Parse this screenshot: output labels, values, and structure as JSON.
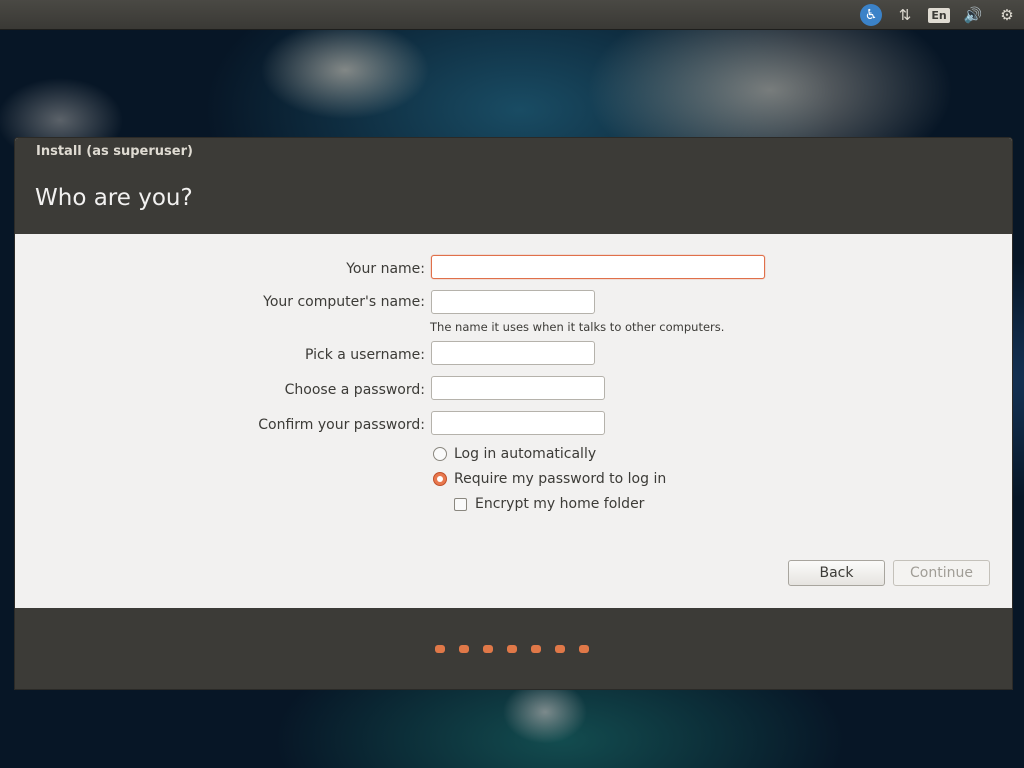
{
  "topbar": {
    "icons": [
      "accessibility-icon",
      "network-icon",
      "keyboard-language-icon",
      "volume-icon",
      "gear-icon"
    ],
    "language": "En",
    "accent_color": "#3b82c8"
  },
  "window": {
    "title": "Install (as superuser)",
    "heading": "Who are you?",
    "form": {
      "name_label": "Your name:",
      "name_value": "",
      "computer_label": "Your computer's name:",
      "computer_value": "",
      "computer_hint": "The name it uses when it talks to other computers.",
      "username_label": "Pick a username:",
      "username_value": "",
      "password_label": "Choose a password:",
      "password_value": "",
      "confirm_label": "Confirm your password:",
      "confirm_value": "",
      "login_auto_label": "Log in automatically",
      "require_password_label": "Require my password to log in",
      "encrypt_label": "Encrypt my home folder",
      "selected_option": "require_password"
    },
    "buttons": {
      "back": "Back",
      "continue": "Continue"
    },
    "progress": {
      "step_count": 7,
      "dot_color": "#e07848"
    }
  }
}
